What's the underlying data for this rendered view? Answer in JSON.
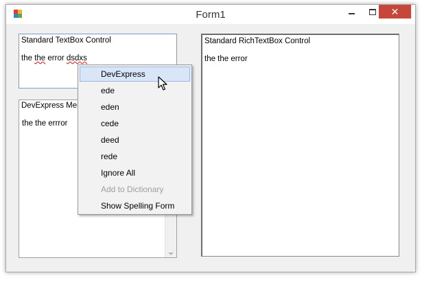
{
  "window": {
    "title": "Form1",
    "icons": {
      "app": "app-icon",
      "minimize": "minimize-icon",
      "maximize": "maximize-icon",
      "close": "close-icon"
    },
    "close_color": "#c7463a"
  },
  "standard_textbox": {
    "label": "Standard TextBox Control",
    "text_before": "the ",
    "text_err1": "the",
    "text_mid": " error ",
    "text_err2": "dsdxs"
  },
  "devexpress_memo": {
    "label": "DevExpress Mem",
    "text": "the the errror"
  },
  "rich_textbox": {
    "label": "Standard RichTextBox Control",
    "text": "the the error"
  },
  "context_menu": {
    "items": [
      {
        "label": "DevExpress",
        "state": "highlighted"
      },
      {
        "label": "ede",
        "state": "normal"
      },
      {
        "label": "eden",
        "state": "normal"
      },
      {
        "label": "cede",
        "state": "normal"
      },
      {
        "label": "deed",
        "state": "normal"
      },
      {
        "label": "rede",
        "state": "normal"
      },
      {
        "label": "Ignore All",
        "state": "normal"
      },
      {
        "label": "Add to Dictionary",
        "state": "disabled"
      },
      {
        "label": "Show Spelling Form",
        "state": "normal"
      }
    ],
    "highlight_color": "#d9e6f7"
  },
  "cursor": "arrow-cursor-icon"
}
